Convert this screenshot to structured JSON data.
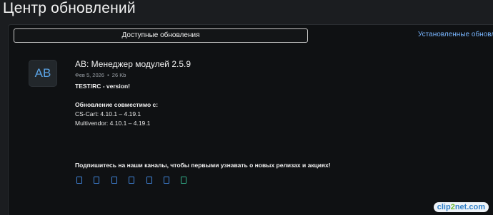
{
  "page": {
    "title": "Центр обновлений"
  },
  "tabs": {
    "available": "Доступные обновления",
    "installed": "Установленные обновления"
  },
  "addon": {
    "logo_text": "AB",
    "title": "AB: Менеджер модулей 2.5.9",
    "date": "Фев 5, 2026",
    "separator": "•",
    "size": "26 Kb",
    "release_note": "TEST/RC - version!",
    "compat_heading": "Обновление совместимо с:",
    "compat": [
      "CS-Cart: 4.10.1 – 4.19.1",
      "Multivendor: 4.10.1 – 4.19.1"
    ]
  },
  "subscribe_text": "Подпишитесь на наши каналы, чтобы первыми узнавать о новых релизах и акциях!",
  "social_icons": [
    "social-icon-1",
    "social-icon-2",
    "social-icon-3",
    "social-icon-4",
    "social-icon-5",
    "social-icon-6",
    "social-icon-7"
  ],
  "watermark": {
    "part1": "clip",
    "part2": "2",
    "part3": "net.com"
  }
}
